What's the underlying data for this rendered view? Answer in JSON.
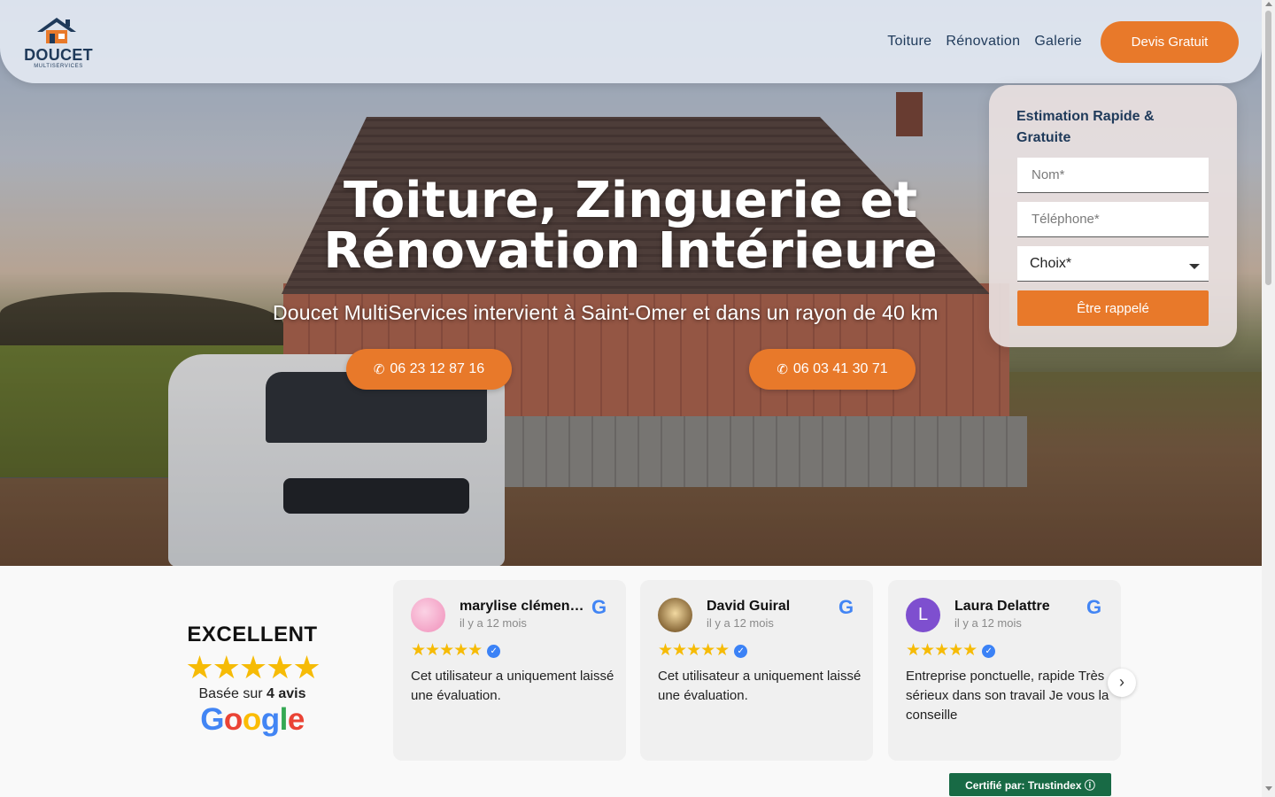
{
  "header": {
    "logo_name": "DOUCET",
    "logo_tagline": "MULTISERVICES",
    "nav": [
      "Toiture",
      "Rénovation",
      "Galerie"
    ],
    "cta_label": "Devis Gratuit"
  },
  "hero": {
    "title": "Toiture, Zinguerie et Rénovation Intérieure",
    "subtitle": "Doucet MultiServices intervient à Saint-Omer et dans un rayon de 40 km",
    "phones": [
      "06 23 12 87 16",
      "06 03 41 30 71"
    ]
  },
  "form": {
    "title": "Estimation Rapide & Gratuite",
    "name_placeholder": "Nom*",
    "phone_placeholder": "Téléphone*",
    "choice_selected": "Choix*",
    "submit_label": "Être rappelé"
  },
  "reviews": {
    "rating_label": "EXCELLENT",
    "based_prefix": "Basée sur",
    "based_count": "4 avis",
    "google_letters": [
      {
        "char": "G",
        "color": "#4285f4"
      },
      {
        "char": "o",
        "color": "#ea4335"
      },
      {
        "char": "o",
        "color": "#fbbc05"
      },
      {
        "char": "g",
        "color": "#4285f4"
      },
      {
        "char": "l",
        "color": "#34a853"
      },
      {
        "char": "e",
        "color": "#ea4335"
      }
    ],
    "items": [
      {
        "name": "marylise clémen…",
        "when": "il y a 12 mois",
        "stars": 5,
        "text": "Cet utilisateur a uniquement laissé une évaluation."
      },
      {
        "name": "David Guiral",
        "when": "il y a 12 mois",
        "stars": 5,
        "text": "Cet utilisateur a uniquement laissé une évaluation."
      },
      {
        "name": "Laura Delattre",
        "when": "il y a 12 mois",
        "stars": 5,
        "text": "Entreprise ponctuelle, rapide Très sérieux dans son travail Je vous la conseille",
        "initial": "L"
      }
    ],
    "certified": "Certifié par: Trustindex ⓘ"
  },
  "colors": {
    "accent": "#e8792a",
    "navy": "#1f3a5a",
    "star": "#f6bb06",
    "trust_green": "#186a45"
  },
  "icons": {
    "phone": "phone-icon",
    "next": "chevron-right-icon",
    "verified": "verified-check-icon"
  }
}
